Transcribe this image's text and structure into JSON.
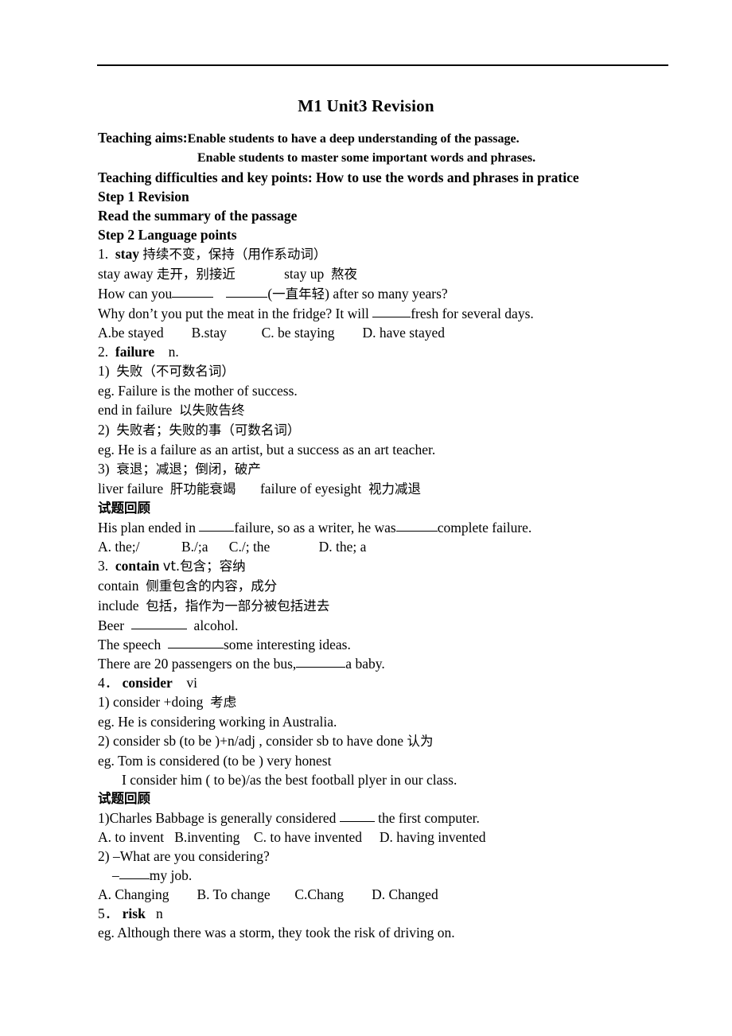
{
  "document": {
    "title": "M1 Unit3 Revision",
    "header_rule": true,
    "aims": {
      "label": "Teaching aims:",
      "line1": "Enable students to have a deep understanding of the passage.",
      "line2": "Enable students to master some important words and phrases."
    },
    "difficulties": "Teaching difficulties and key points: How to use the words and phrases in pratice",
    "step1": {
      "heading": "Step 1 Revision",
      "instruction": "Read the summary of the passage"
    },
    "step2": {
      "heading": "Step 2 Language points"
    },
    "points": [
      {
        "number": "1.",
        "word": "stay",
        "gloss": "持续不变，保持（用作系动词）",
        "lines": [
          "stay away 走开，别接近            stay up  熬夜",
          "How can you______  ______(一直年轻) after so many years?",
          "Why don’t you put the meat in the fridge? It will  _____fresh for several days.",
          "A.be stayed          B.stay            C. be staying          D. have stayed"
        ],
        "exercise_options": [
          "A.be stayed",
          "B.stay",
          "C. be staying",
          "D. have stayed"
        ]
      },
      {
        "number": "2.",
        "word": "failure",
        "pos": "n.",
        "senses": [
          {
            "index": "1)",
            "meaning": "失败（不可数名词）",
            "example": "eg. Failure is the mother of success.",
            "phrase": "end in failure  以失败告终"
          },
          {
            "index": "2)",
            "meaning": "失败者；失败的事（可数名词）",
            "example": "eg. He is a failure as an artist, but a success as an art teacher."
          },
          {
            "index": "3)",
            "meaning": "衰退；减退；倒闭，破产",
            "phrase": "liver failure  肝功能衰竭        failure of eyesight  视力减退"
          }
        ],
        "review": {
          "heading": "试题回顾",
          "question": "His plan ended in  _____failure, so as a writer, he was______complete failure.",
          "options": [
            "A. the;/",
            "B./;a",
            "C./; the",
            "D. the; a"
          ]
        }
      },
      {
        "number": "3.",
        "word": "contain",
        "pos": "vt.包含；容纳",
        "lines": [
          "contain  侧重包含的内容，成分",
          "include  包括，指作为一部分被包括进去",
          "Beer  ________  alcohol.",
          "The speech  __________some interesting ideas.",
          "There are 20 passengers on the bus,________a baby."
        ]
      },
      {
        "number": "4．",
        "word": "consider",
        "pos": "vi",
        "usages": [
          {
            "index": "1)",
            "pattern": "consider +doing  考虑",
            "example": "eg. He is considering working in Australia."
          },
          {
            "index": "2)",
            "pattern": "consider sb (to be )+n/adj , consider sb to have done 认为",
            "example": "eg. Tom is considered (to be ) very honest",
            "example2": "I consider him ( to be)/as the best football plyer in our class."
          }
        ],
        "review": {
          "heading": "试题回顾",
          "q1": "1)Charles Babbage is generally considered  _____  the first computer.",
          "q1_options": [
            "A. to invent",
            "B.inventing",
            "C. to have invented",
            "D. having invented"
          ],
          "q2_line1": "2) –What are you considering?",
          "q2_line2": "–____my job.",
          "q2_options": [
            "A. Changing",
            "B. To change",
            "C.Chang",
            "D. Changed"
          ]
        }
      },
      {
        "number": "5．",
        "word": "risk",
        "pos": "n",
        "example": "eg. Although there was a storm, they took the risk of driving on."
      }
    ]
  }
}
